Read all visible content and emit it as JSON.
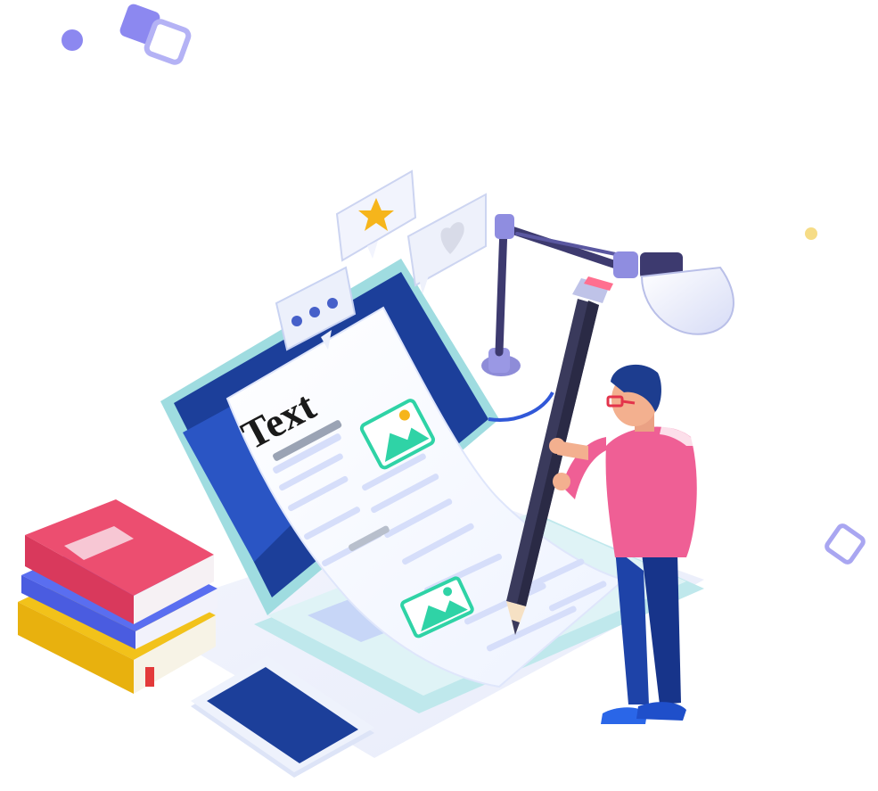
{
  "illustration": {
    "document_heading": "Text",
    "icons": {
      "chat_bubble": "ellipsis-icon",
      "star_bubble": "star-icon",
      "heart_bubble": "heart-icon",
      "image_placeholder": "image-icon"
    },
    "colors": {
      "background": "#ffffff",
      "laptop_screen": "#1c3f9a",
      "laptop_frame": "#9fdce0",
      "pencil_body": "#3a3a5c",
      "pencil_tip": "#ff6f8f",
      "shirt": "#ef5f95",
      "jeans": "#1e43a8",
      "hair": "#1d3d8f",
      "book_pink": "#ec4e70",
      "book_blue": "#5a6ef0",
      "book_yellow": "#f2c21a",
      "lamp_arm": "#3d3a6f",
      "lamp_shade": "#e9ecfb",
      "accent_purple": "#8c88f0",
      "accent_green": "#2fd3a6",
      "star_yellow": "#f6b51b"
    }
  }
}
